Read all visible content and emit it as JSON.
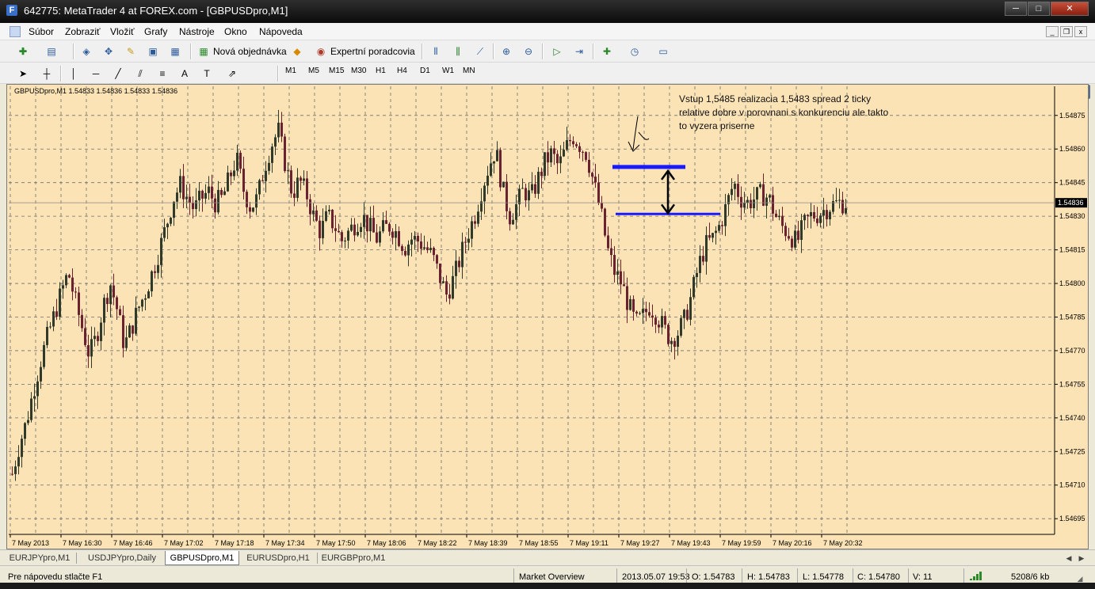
{
  "window": {
    "title": "642775: MetaTrader 4 at FOREX.com - [GBPUSDpro,M1]",
    "logo_letter": "F",
    "min_glyph": "─",
    "max_glyph": "□",
    "close_glyph": "✕",
    "mdi_min": "_",
    "mdi_restore": "❐",
    "mdi_close": "x"
  },
  "menu": {
    "items": [
      "Súbor",
      "Zobraziť",
      "Vložiť",
      "Grafy",
      "Nástroje",
      "Okno",
      "Nápoveda"
    ]
  },
  "toolbar": {
    "new_order_label": "Nová objednávka",
    "expert_label": "Expertní poradcovia",
    "side_badge": "4"
  },
  "timeframes": [
    "M1",
    "M5",
    "M15",
    "M30",
    "H1",
    "H4",
    "D1",
    "W1",
    "MN"
  ],
  "chart": {
    "symbol_info": "GBPUSDpro,M1  1.54833 1.54836 1.54833 1.54836",
    "annotation_lines": [
      "Vstup 1,5485 realizacia 1,5483 spread 2 ticky",
      "relative dobre v porovnani s konkurenciu ale takto",
      "to vyzera priserne"
    ],
    "current_price": "1.54836",
    "colors": {
      "background": "#fbe3b6",
      "grid": "#6e6e6e",
      "bull": "#2f3a2a",
      "bear": "#6b2230",
      "blue_lines": "#1a1aff"
    }
  },
  "chart_data": {
    "type": "candlestick",
    "ylim": [
      1.54688,
      1.54888
    ],
    "y_ticks": [
      "1.54875",
      "1.54860",
      "1.54845",
      "1.54830",
      "1.54815",
      "1.54800",
      "1.54785",
      "1.54770",
      "1.54755",
      "1.54740",
      "1.54725",
      "1.54710",
      "1.54695"
    ],
    "x_ticks": [
      "7 May 2013",
      "7 May 16:30",
      "7 May 16:46",
      "7 May 17:02",
      "7 May 17:18",
      "7 May 17:34",
      "7 May 17:50",
      "7 May 18:06",
      "7 May 18:22",
      "7 May 18:39",
      "7 May 18:55",
      "7 May 19:11",
      "7 May 19:27",
      "7 May 19:43",
      "7 May 19:59",
      "7 May 20:16",
      "7 May 20:32"
    ],
    "close_path": [
      1.54715,
      1.54728,
      1.54738,
      1.54752,
      1.54765,
      1.54776,
      1.54786,
      1.54796,
      1.54805,
      1.54792,
      1.5478,
      1.54768,
      1.54776,
      1.5479,
      1.548,
      1.54788,
      1.54772,
      1.5478,
      1.54789,
      1.54796,
      1.54805,
      1.54815,
      1.54826,
      1.54838,
      1.54844,
      1.54838,
      1.54833,
      1.54838,
      1.54841,
      1.54836,
      1.54838,
      1.54847,
      1.54856,
      1.54842,
      1.54834,
      1.54838,
      1.54852,
      1.54862,
      1.54868,
      1.54853,
      1.5484,
      1.54846,
      1.5484,
      1.5483,
      1.54823,
      1.5483,
      1.54826,
      1.54819,
      1.54823,
      1.54827,
      1.5483,
      1.54825,
      1.5482,
      1.54824,
      1.54826,
      1.54822,
      1.54816,
      1.5482,
      1.54819,
      1.54816,
      1.54812,
      1.54803,
      1.54795,
      1.54802,
      1.54812,
      1.54822,
      1.5483,
      1.54842,
      1.54852,
      1.5486,
      1.54842,
      1.5483,
      1.54835,
      1.54842,
      1.54838,
      1.54846,
      1.54854,
      1.54858,
      1.54852,
      1.5486,
      1.54866,
      1.54862,
      1.54858,
      1.54845,
      1.54832,
      1.54815,
      1.54805,
      1.548,
      1.5479,
      1.54782,
      1.54785,
      1.5479,
      1.54786,
      1.5478,
      1.54775,
      1.54778,
      1.54784,
      1.54795,
      1.54808,
      1.54817,
      1.5482,
      1.54826,
      1.54835,
      1.54845,
      1.54838,
      1.54836,
      1.54838,
      1.5484,
      1.54838,
      1.5483,
      1.54825,
      1.54822,
      1.54818,
      1.54826,
      1.5483,
      1.54831,
      1.54833,
      1.54835,
      1.54836,
      1.54836
    ],
    "volume_bars": 12,
    "annotations": {
      "entry_price": 1.54852,
      "fill_price": 1.54831
    }
  },
  "tabs": [
    "EURJPYpro,M1",
    "USDJPYpro,Daily",
    "GBPUSDpro,M1",
    "EURUSDpro,H1",
    "EURGBPpro,M1"
  ],
  "active_tab": "GBPUSDpro,M1",
  "statusbar": {
    "help": "Pre nápovedu stlačte F1",
    "profile": "Market Overview",
    "datetime": "2013.05.07 19:53",
    "open": "O: 1.54783",
    "high": "H: 1.54783",
    "low": "L: 1.54778",
    "close": "C: 1.54780",
    "volume": "V: 11",
    "traffic": "5208/6 kb"
  }
}
